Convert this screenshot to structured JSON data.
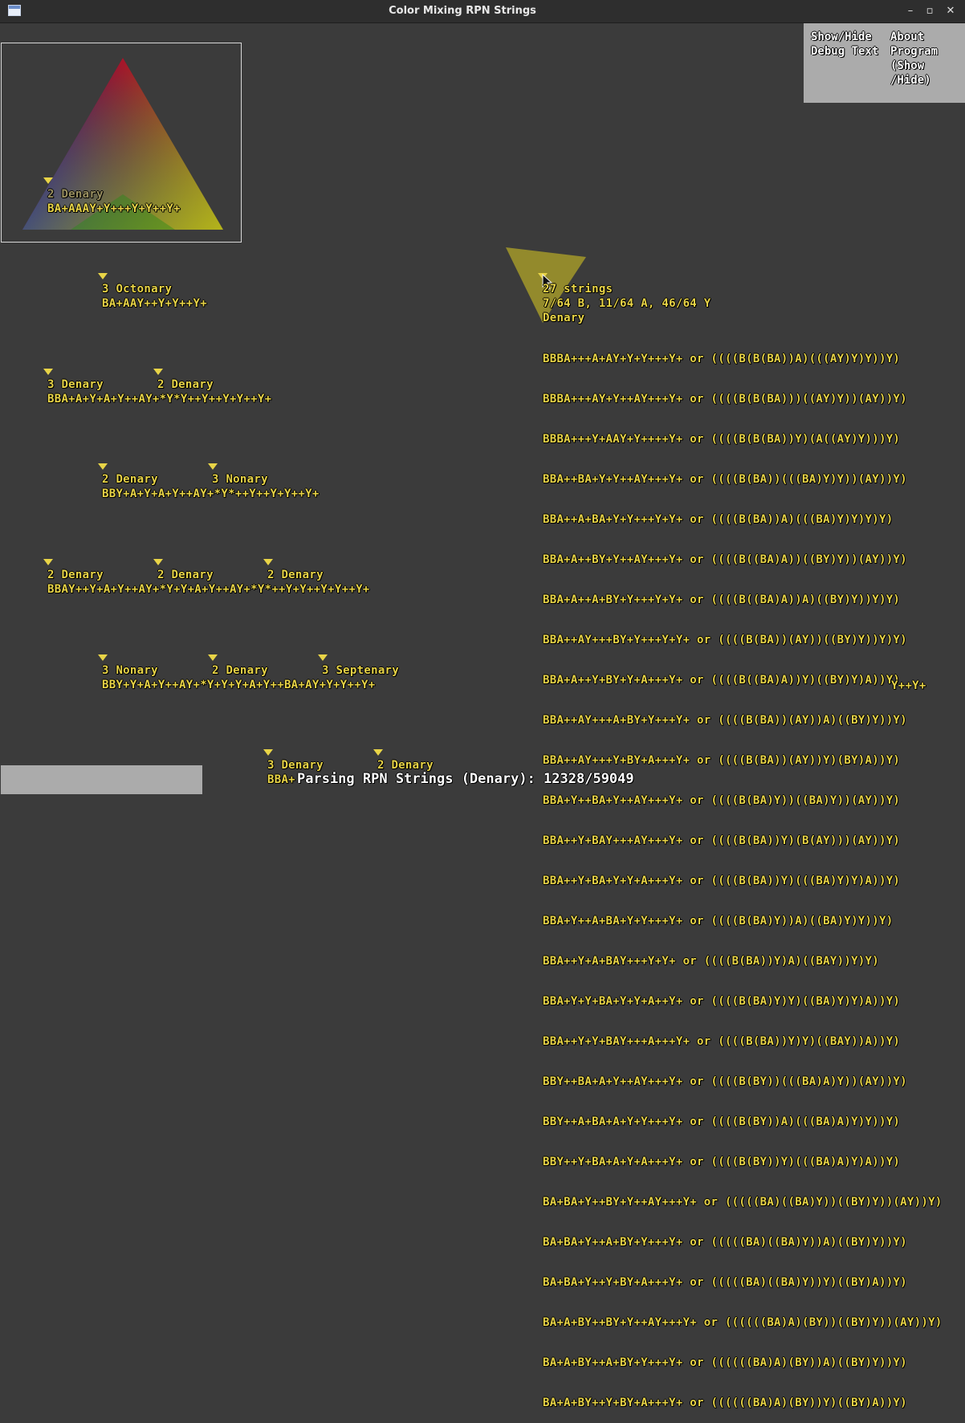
{
  "window": {
    "title": "Color Mixing RPN Strings",
    "minimize": "–",
    "maximize": "▫",
    "close": "✕"
  },
  "menu": {
    "debug_toggle": "Show/Hide\nDebug Text",
    "about_toggle": "About\nProgram\n(Show\n/Hide)"
  },
  "preview": {
    "base_label": "2 Denary",
    "string": "BA+AAAY+Y+++Y+Y++Y+",
    "colors": {
      "top": "#a8162a",
      "left": "#1a2a9a",
      "right": "#b4b41a",
      "center": "#3a2a28"
    }
  },
  "tree": {
    "n1": {
      "label": "3 Octonary",
      "string": "BA+AAY++Y+Y++Y+"
    },
    "n2": {
      "label_a": "3 Denary",
      "label_b": "2 Denary",
      "string": "BBA+A+Y+A+Y++AY+*Y*Y++Y++Y+Y++Y+"
    },
    "n3": {
      "label_a": "2 Denary",
      "label_b": "3 Nonary",
      "string": "BBY+A+Y+A+Y++AY+*Y*++Y++Y+Y++Y+"
    },
    "n4": {
      "label_a": "2 Denary",
      "label_b": "2 Denary",
      "label_c": "2 Denary",
      "string": "BBAY++Y+A+Y++AY+*Y+Y+A+Y++AY+*Y*++Y+Y++Y+Y++Y+"
    },
    "n5": {
      "label_a": "3 Nonary",
      "label_b": "2 Denary",
      "label_c": "3 Septenary",
      "string": "BBY+Y+A+Y++AY+*Y+Y+Y+A+Y++BA+AY+Y+Y++Y+"
    },
    "n6": {
      "label_a": "3 Denary",
      "label_b": "2 Denary",
      "string": "BBA+"
    }
  },
  "detail": {
    "count": "27 strings",
    "ratio": "7/64 B, 11/64 A, 46/64 Y",
    "base": "Denary",
    "overflow": "Y++Y+",
    "rows": [
      "BBBA+++A+AY+Y+Y+++Y+ or ((((B(B(BA))A)(((AY)Y)Y))Y)",
      "BBBA+++AY+Y++AY+++Y+ or ((((B(B(BA)))((AY)Y))(AY))Y)",
      "BBBA+++Y+AAY+Y++++Y+ or ((((B(B(BA))Y)(A((AY)Y)))Y)",
      "BBA++BA+Y+Y++AY+++Y+ or ((((B(BA))(((BA)Y)Y))(AY))Y)",
      "BBA++A+BA+Y+Y+++Y+Y+ or ((((B(BA))A)(((BA)Y)Y)Y)Y)",
      "BBA+A++BY+Y++AY+++Y+ or ((((B((BA)A))((BY)Y))(AY))Y)",
      "BBA+A++A+BY+Y+++Y+Y+ or ((((B((BA)A))A)((BY)Y))Y)Y)",
      "BBA++AY+++BY+Y+++Y+Y+ or ((((B(BA))(AY))((BY)Y))Y)Y)",
      "BBA+A++Y+BY+Y+A+++Y+ or ((((B((BA)A))Y)((BY)Y)A))Y)",
      "BBA++AY+++A+BY+Y+++Y+ or ((((B(BA))(AY))A)((BY)Y))Y)",
      "BBA++AY+++Y+BY+A+++Y+ or ((((B(BA))(AY))Y)(BY)A))Y)",
      "BBA+Y++BA+Y++AY+++Y+ or ((((B(BA)Y))((BA)Y))(AY))Y)",
      "BBA++Y+BAY+++AY+++Y+ or ((((B(BA))Y)(B(AY)))(AY))Y)",
      "BBA++Y+BA+Y+Y+A+++Y+ or ((((B(BA))Y)(((BA)Y)Y)A))Y)",
      "BBA+Y++A+BA+Y+Y+++Y+ or ((((B(BA)Y))A)((BA)Y)Y))Y)",
      "BBA++Y+A+BAY+++Y+Y+ or ((((B(BA))Y)A)((BAY))Y)Y)",
      "BBA+Y+Y+BA+Y+Y+A++Y+ or ((((B(BA)Y)Y)((BA)Y)Y)A))Y)",
      "BBA++Y+Y+BAY+++A+++Y+ or ((((B(BA))Y)Y)((BAY))A))Y)",
      "BBY++BA+A+Y++AY+++Y+ or ((((B(BY))(((BA)A)Y))(AY))Y)",
      "BBY++A+BA+A+Y+Y+++Y+ or ((((B(BY))A)(((BA)A)Y)Y))Y)",
      "BBY++Y+BA+A+Y+A+++Y+ or ((((B(BY))Y)(((BA)A)Y)A))Y)",
      "BA+BA+Y++BY+Y++AY+++Y+ or (((((BA)((BA)Y))((BY)Y))(AY))Y)",
      "BA+BA+Y++A+BY+Y+++Y+ or (((((BA)((BA)Y))A)((BY)Y))Y)",
      "BA+BA+Y++Y+BY+A+++Y+ or (((((BA)((BA)Y))Y)((BY)A))Y)",
      "BA+A+BY++BY+Y++AY+++Y+ or ((((((BA)A)(BY))((BY)Y))(AY))Y)",
      "BA+A+BY++A+BY+Y+++Y+ or ((((((BA)A)(BY))A)((BY)Y))Y)",
      "BA+A+BY++Y+BY+A+++Y+ or ((((((BA)A)(BY))Y)((BY)A))Y)"
    ]
  },
  "status": {
    "text": "Parsing RPN Strings (Denary): 12328/59049"
  }
}
